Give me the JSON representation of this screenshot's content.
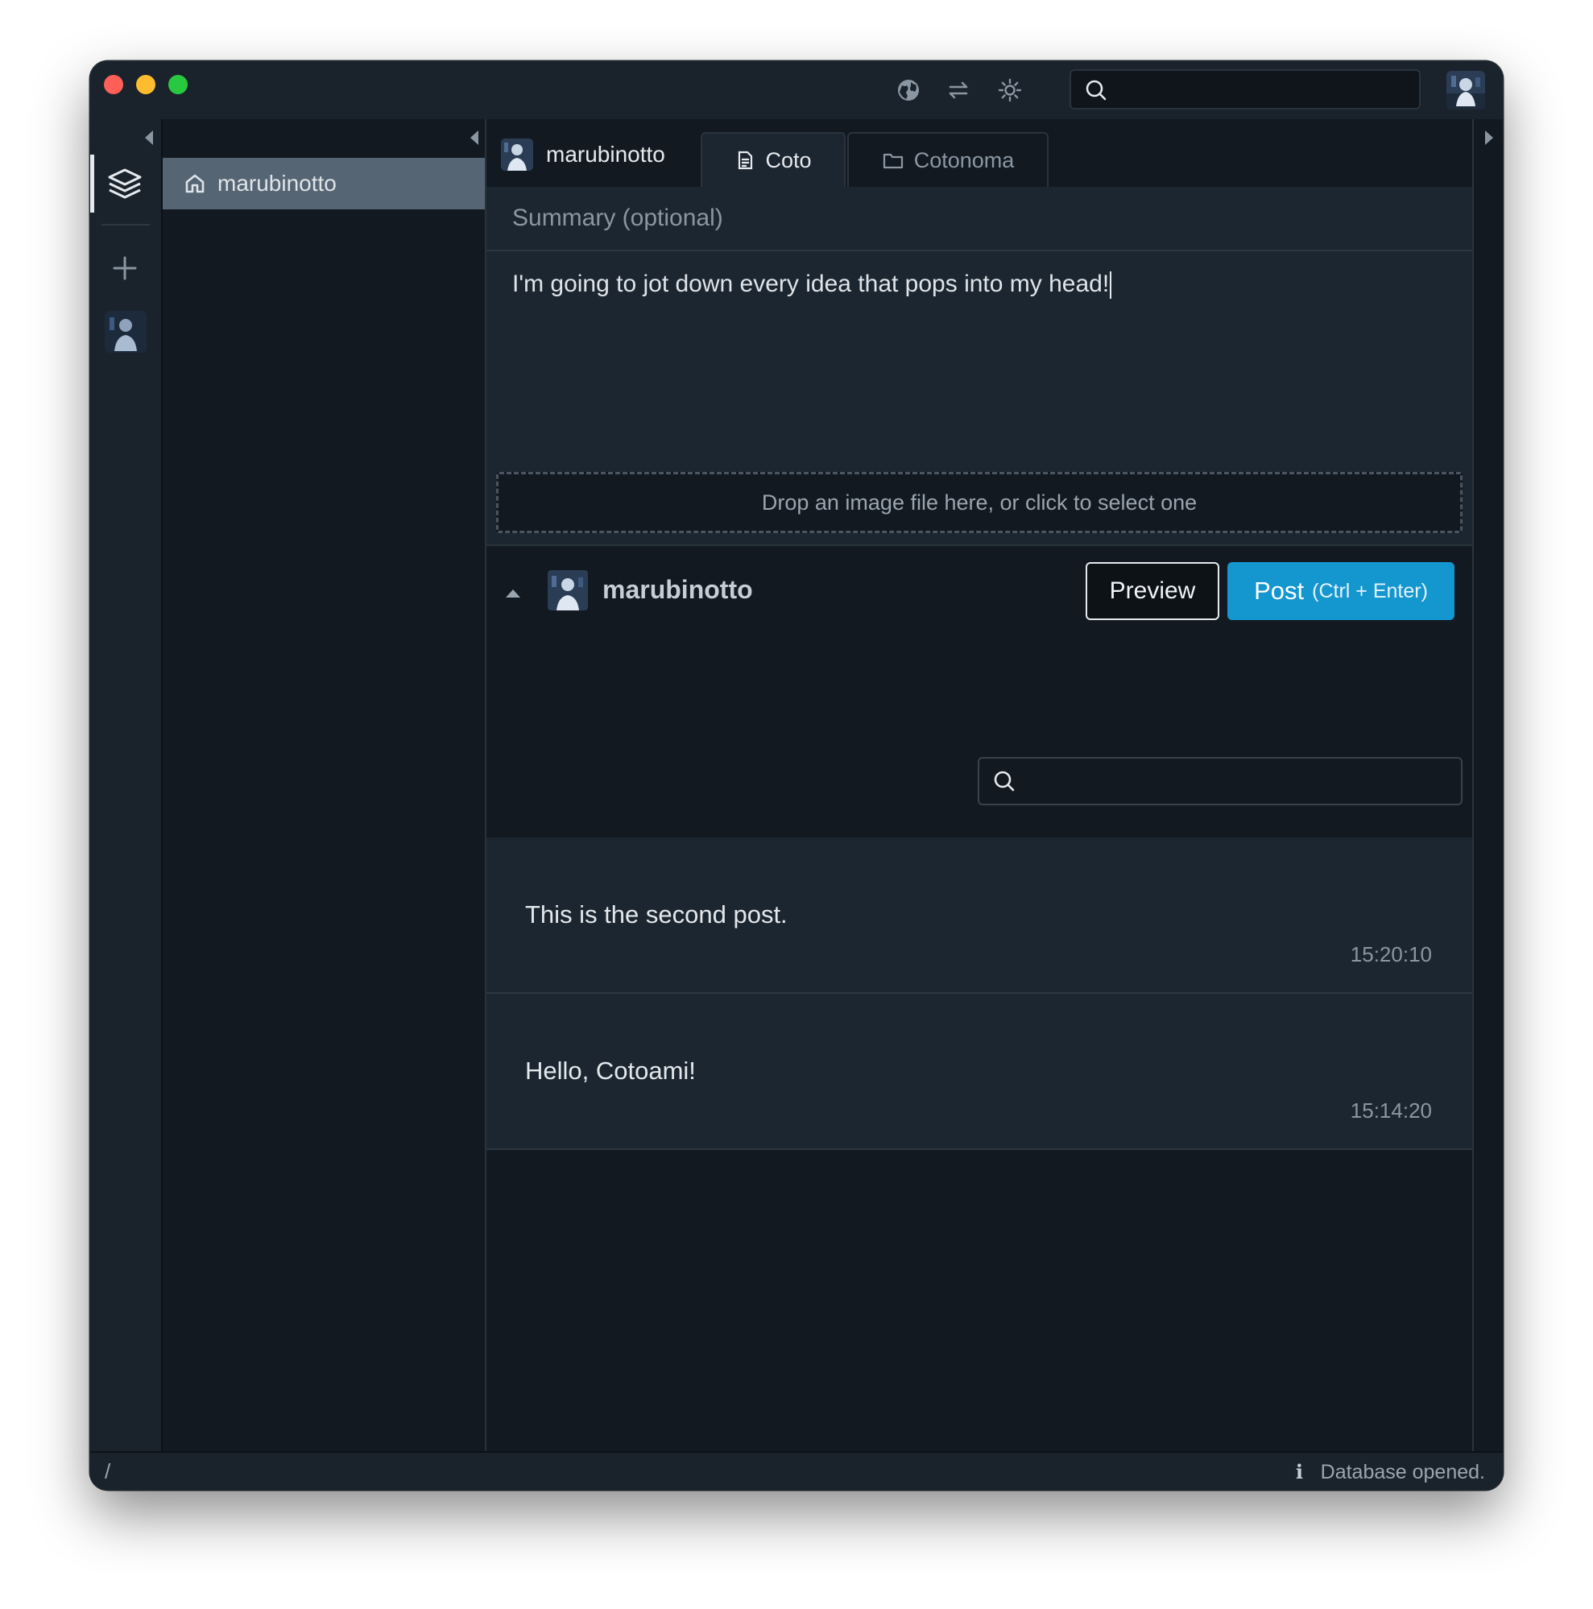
{
  "nav": {
    "home_label": "marubinotto"
  },
  "composer": {
    "owner_name": "marubinotto",
    "tabs": [
      {
        "label": "Coto",
        "icon": "document-icon",
        "active": true
      },
      {
        "label": "Cotonoma",
        "icon": "folder-icon",
        "active": false
      }
    ],
    "summary_placeholder": "Summary (optional)",
    "content_value": "I'm going to jot down every idea that pops into my head!",
    "dropzone_text": "Drop an image file here, or click to select one",
    "poster_name": "marubinotto",
    "preview_label": "Preview",
    "post_label": "Post",
    "post_shortcut": "(Ctrl + Enter)"
  },
  "timeline": {
    "posts": [
      {
        "text": "This is the second post.",
        "time": "15:20:10"
      },
      {
        "text": "Hello, Cotoami!",
        "time": "15:14:20"
      }
    ]
  },
  "status": {
    "path": "/",
    "message": "Database opened."
  },
  "colors": {
    "accent": "#1496cf",
    "background": "#121920",
    "panel": "#1c2630"
  }
}
